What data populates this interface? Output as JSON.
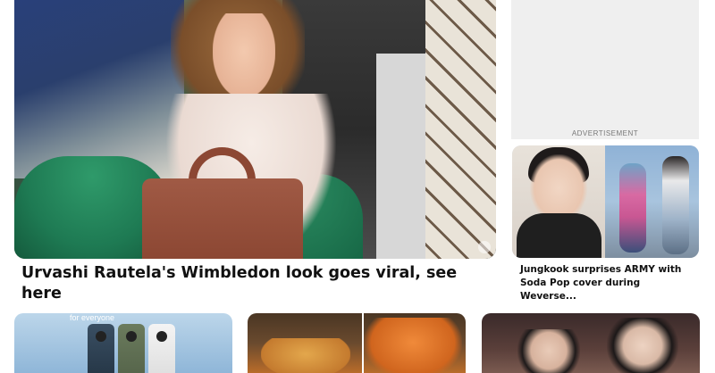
{
  "hero": {
    "image_alt": "Urvashi Rautela at Wimbledon holding a brown crocodile handbag",
    "headline": "Urvashi Rautela's Wimbledon look goes viral, see here"
  },
  "advertisement": {
    "label": "ADVERTISEMENT"
  },
  "side_story": {
    "headline": "Jungkook surprises ARMY with Soda Pop cover during Weverse..."
  },
  "bottom_cards": [
    {
      "name": "phones",
      "tag": "for everyone"
    },
    {
      "name": "food"
    },
    {
      "name": "drama"
    }
  ]
}
